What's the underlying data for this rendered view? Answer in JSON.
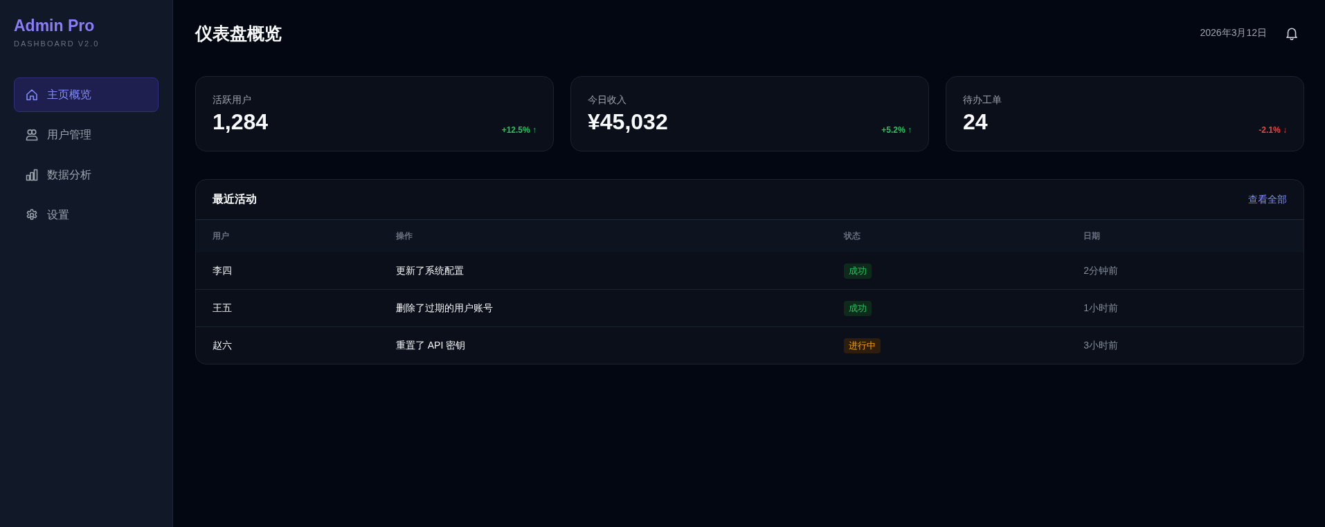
{
  "sidebar": {
    "logo": "Admin Pro",
    "subtitle": "DASHBOARD V2.0",
    "items": [
      {
        "label": "主页概览",
        "selected": true
      },
      {
        "label": "用户管理",
        "selected": false
      },
      {
        "label": "数据分析",
        "selected": false
      },
      {
        "label": "设置",
        "selected": false
      }
    ]
  },
  "header": {
    "title": "仪表盘概览",
    "date": "2026年3月12日"
  },
  "stats": [
    {
      "label": "活跃用户",
      "value": "1,284",
      "change": "+12.5% ↑",
      "rising": true
    },
    {
      "label": "今日收入",
      "value": "¥45,032",
      "change": "+5.2% ↑",
      "rising": true
    },
    {
      "label": "待办工单",
      "value": "24",
      "change": "-2.1% ↓",
      "rising": false
    }
  ],
  "activity": {
    "title": "最近活动",
    "link": "查看全部",
    "columns": [
      "用户",
      "操作",
      "状态",
      "日期"
    ],
    "rows": [
      {
        "user": "李四",
        "action": "更新了系统配置",
        "status": {
          "text": "成功",
          "kind": "success"
        },
        "time": "2分钟前"
      },
      {
        "user": "王五",
        "action": "删除了过期的用户账号",
        "status": {
          "text": "成功",
          "kind": "success"
        },
        "time": "1小时前"
      },
      {
        "user": "赵六",
        "action": "重置了 API 密钥",
        "status": {
          "text": "进行中",
          "kind": "pending"
        },
        "time": "3小时前"
      }
    ]
  }
}
